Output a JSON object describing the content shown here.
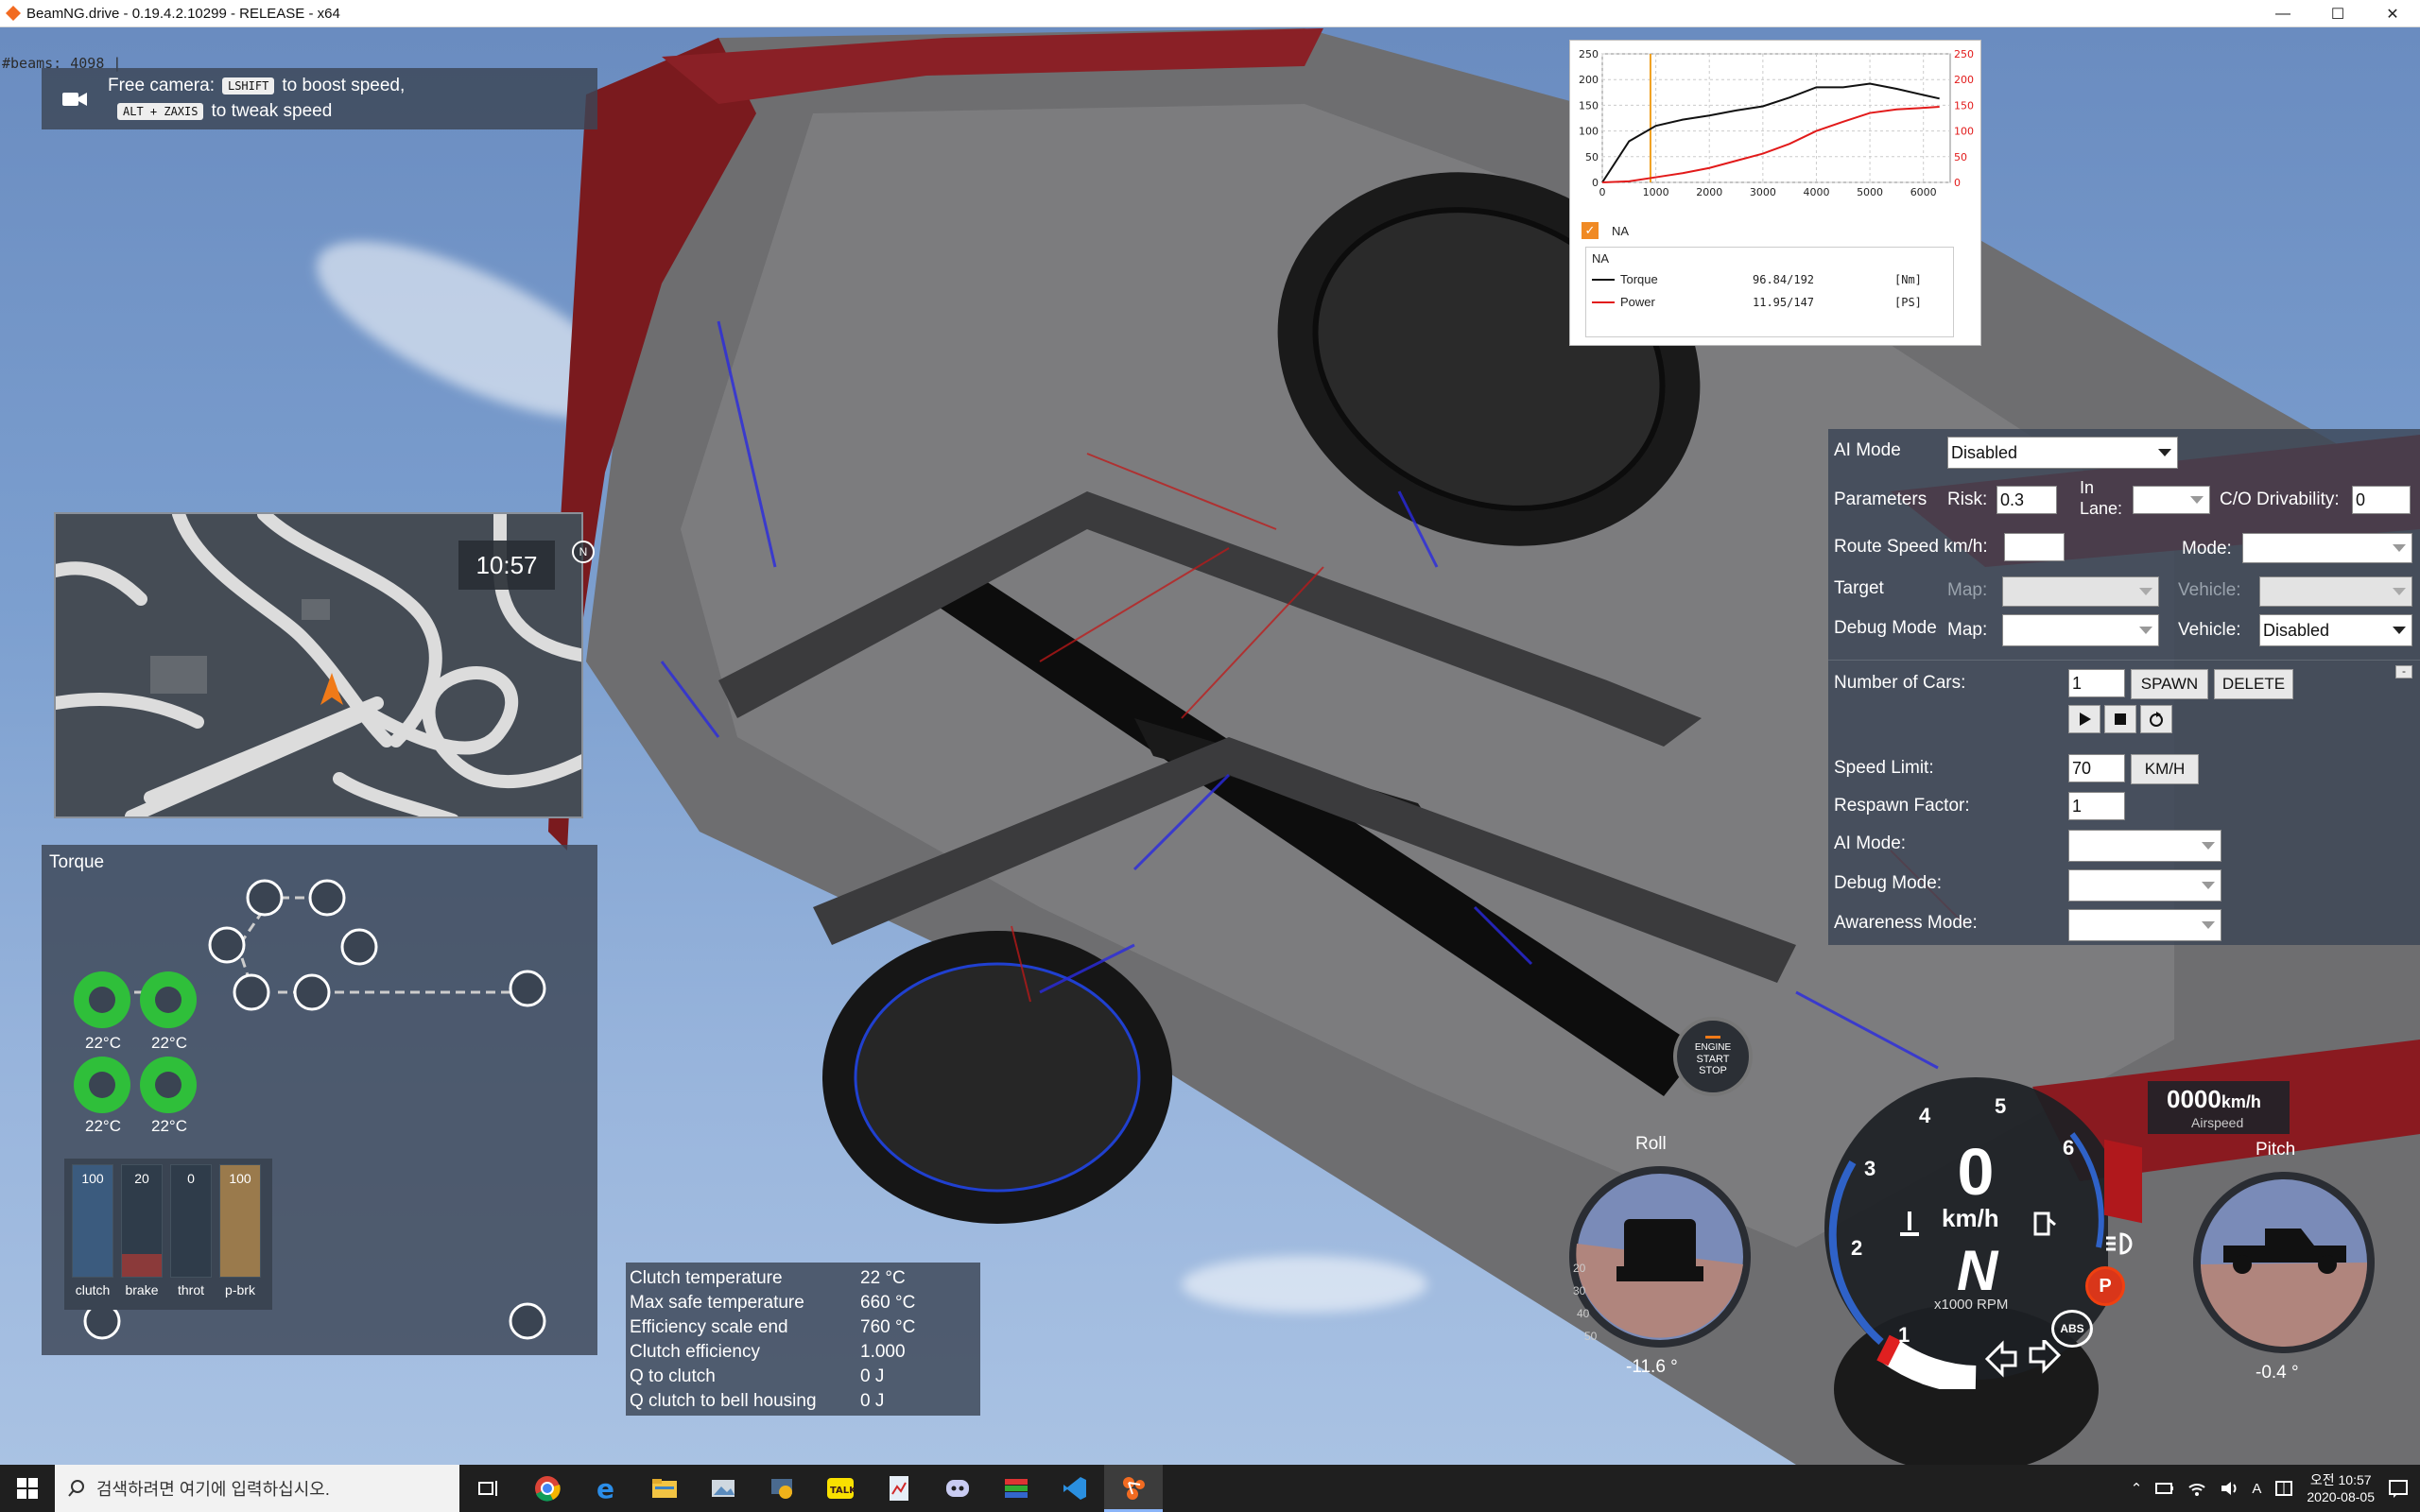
{
  "window": {
    "title": "BeamNG.drive - 0.19.4.2.10299 - RELEASE - x64",
    "min_glyph": "—",
    "max_glyph": "☐",
    "close_glyph": "✕"
  },
  "debug": {
    "beams": "#beams: 4098 |"
  },
  "free_camera": {
    "prefix": "Free camera:",
    "key1": "LSHIFT",
    "suffix1": "to boost speed,",
    "key2": "ALT + ZAXIS",
    "suffix2": "to tweak speed"
  },
  "minimap": {
    "time": "10:57",
    "north": "N"
  },
  "powertrain": {
    "title": "Torque",
    "wheel_temps": [
      "22°C",
      "22°C",
      "22°C",
      "22°C"
    ],
    "bars": [
      {
        "label": "clutch",
        "value": "100",
        "level": 1.0,
        "color": "#3b5b7e"
      },
      {
        "label": "brake",
        "value": "20",
        "level": 0.2,
        "color": "#8b3a3a"
      },
      {
        "label": "throt",
        "value": "0",
        "level": 0.0,
        "color": "#3b5b7e"
      },
      {
        "label": "p-brk",
        "value": "100",
        "level": 1.0,
        "color": "#9a7a4c"
      }
    ]
  },
  "clutch_info": {
    "rows": [
      {
        "key": "Clutch temperature",
        "value": "22 °C"
      },
      {
        "key": "Max safe temperature",
        "value": "660 °C"
      },
      {
        "key": "Efficiency scale end",
        "value": "760 °C"
      },
      {
        "key": "Clutch efficiency",
        "value": "1.000"
      },
      {
        "key": "Q to clutch",
        "value": "0 J"
      },
      {
        "key": "Q clutch to bell housing",
        "value": "0 J"
      }
    ]
  },
  "engine_graph": {
    "checkbox_label": "NA",
    "legend_title": "NA",
    "legend": [
      {
        "name": "Torque",
        "value": "96.84/192",
        "unit": "[Nm]",
        "color": "#111111"
      },
      {
        "name": "Power",
        "value": "11.95/147",
        "unit": "[PS]",
        "color": "#e21a1a"
      }
    ],
    "chart_data": {
      "type": "line",
      "x": [
        0,
        500,
        1000,
        1500,
        2000,
        2500,
        3000,
        3500,
        4000,
        4500,
        5000,
        5500,
        6000,
        6300
      ],
      "series": [
        {
          "name": "Torque",
          "axis": "left",
          "color": "#111111",
          "values": [
            0,
            80,
            110,
            122,
            130,
            140,
            148,
            165,
            185,
            185,
            192,
            182,
            170,
            163
          ]
        },
        {
          "name": "Power",
          "axis": "right",
          "color": "#e21a1a",
          "values": [
            0,
            2,
            10,
            18,
            28,
            42,
            56,
            75,
            100,
            118,
            135,
            142,
            145,
            147
          ]
        }
      ],
      "marker_x": 900,
      "xticks": [
        "0",
        "1000",
        "2000",
        "3000",
        "4000",
        "5000",
        "6000"
      ],
      "yticks_left": [
        "250",
        "200",
        "150",
        "100",
        "50",
        "0"
      ],
      "yticks_right": [
        "250",
        "200",
        "150",
        "100",
        "50",
        "0"
      ],
      "xlim": [
        0,
        6500
      ],
      "ylim": [
        0,
        250
      ],
      "grid": true
    }
  },
  "ai": {
    "ai_mode_label": "AI Mode",
    "ai_mode_value": "Disabled",
    "parameters_label": "Parameters",
    "risk_label": "Risk:",
    "risk_value": "0.3",
    "in_lane_label1": "In",
    "in_lane_label2": "Lane:",
    "co_drivability_label": "C/O Drivability:",
    "co_drivability_value": "0",
    "route_speed_label": "Route Speed km/h:",
    "route_speed_value": "",
    "mode_label": "Mode:",
    "target_label": "Target",
    "map_label": "Map:",
    "vehicle_label": "Vehicle:",
    "debug_mode_label": "Debug Mode",
    "debug_vehicle_value": "Disabled",
    "num_cars_label": "Number of Cars:",
    "num_cars_value": "1",
    "spawn": "SPAWN",
    "delete": "DELETE",
    "minimize": "-",
    "speed_limit_label": "Speed Limit:",
    "speed_limit_value": "70",
    "speed_unit_button": "KM/H",
    "respawn_label": "Respawn Factor:",
    "respawn_value": "1",
    "ai_mode2_label": "AI Mode:",
    "debug_mode2_label": "Debug Mode:",
    "awareness_label": "Awareness Mode:"
  },
  "dash": {
    "engine_btn1": "ENGINE",
    "engine_btn2": "START",
    "engine_btn3": "STOP",
    "speed": "0",
    "speed_unit": "km/h",
    "gear": "N",
    "rpm_unit": "x1000 RPM",
    "rpm_ticks": [
      "1",
      "2",
      "3",
      "4",
      "5",
      "6"
    ],
    "airspeed_value": "0000",
    "airspeed_unit": "km/h",
    "airspeed_label": "Airspeed",
    "roll_label": "Roll",
    "roll_value": "-11.6 °",
    "roll_scale": [
      "20",
      "30",
      "40",
      "50"
    ],
    "pitch_label": "Pitch",
    "pitch_value": "-0.4 °",
    "parking": "P",
    "abs": "ABS"
  },
  "taskbar": {
    "search_placeholder": "검색하려면 여기에 입력하십시오.",
    "time": "오전 10:57",
    "date": "2020-08-05",
    "ime": "A"
  }
}
